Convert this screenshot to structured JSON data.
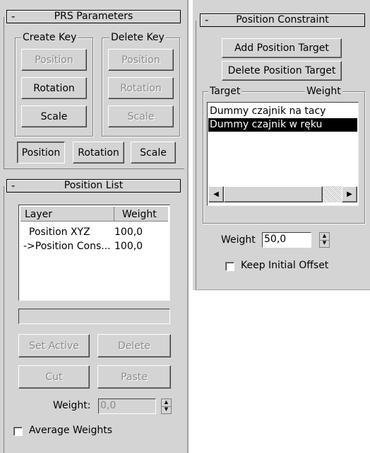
{
  "prs": {
    "title": "PRS Parameters",
    "collapse": "-",
    "create_key": {
      "label": "Create Key",
      "position": "Position",
      "rotation": "Rotation",
      "scale": "Scale"
    },
    "delete_key": {
      "label": "Delete Key",
      "position": "Position",
      "rotation": "Rotation",
      "scale": "Scale"
    },
    "modes": {
      "position": "Position",
      "rotation": "Rotation",
      "scale": "Scale"
    }
  },
  "position_list": {
    "title": "Position List",
    "collapse": "-",
    "columns": {
      "layer": "Layer",
      "weight": "Weight"
    },
    "rows": [
      {
        "layer": "Position XYZ",
        "weight": "100,0"
      },
      {
        "layer": "->Position Cons...",
        "weight": "100,0"
      }
    ],
    "name_field": "",
    "set_active": "Set Active",
    "delete": "Delete",
    "cut": "Cut",
    "paste": "Paste",
    "weight_label": "Weight:",
    "weight_value": "0,0",
    "average_weights": "Average Weights"
  },
  "position_constraint": {
    "title": "Position Constraint",
    "collapse": "-",
    "add_target": "Add Position Target",
    "delete_target": "Delete Position Target",
    "target_col": "Target",
    "weight_col": "Weight",
    "targets": [
      "Dummy czajnik na tacy",
      "Dummy czajnik w ręku"
    ],
    "selected_index": 1,
    "weight_label": "Weight",
    "weight_value": "50,0",
    "keep_initial_offset": "Keep Initial Offset"
  },
  "colors": {
    "panel": "#d4d4d4",
    "selection": "#000000",
    "disabled_text": "#8a8a8a"
  }
}
